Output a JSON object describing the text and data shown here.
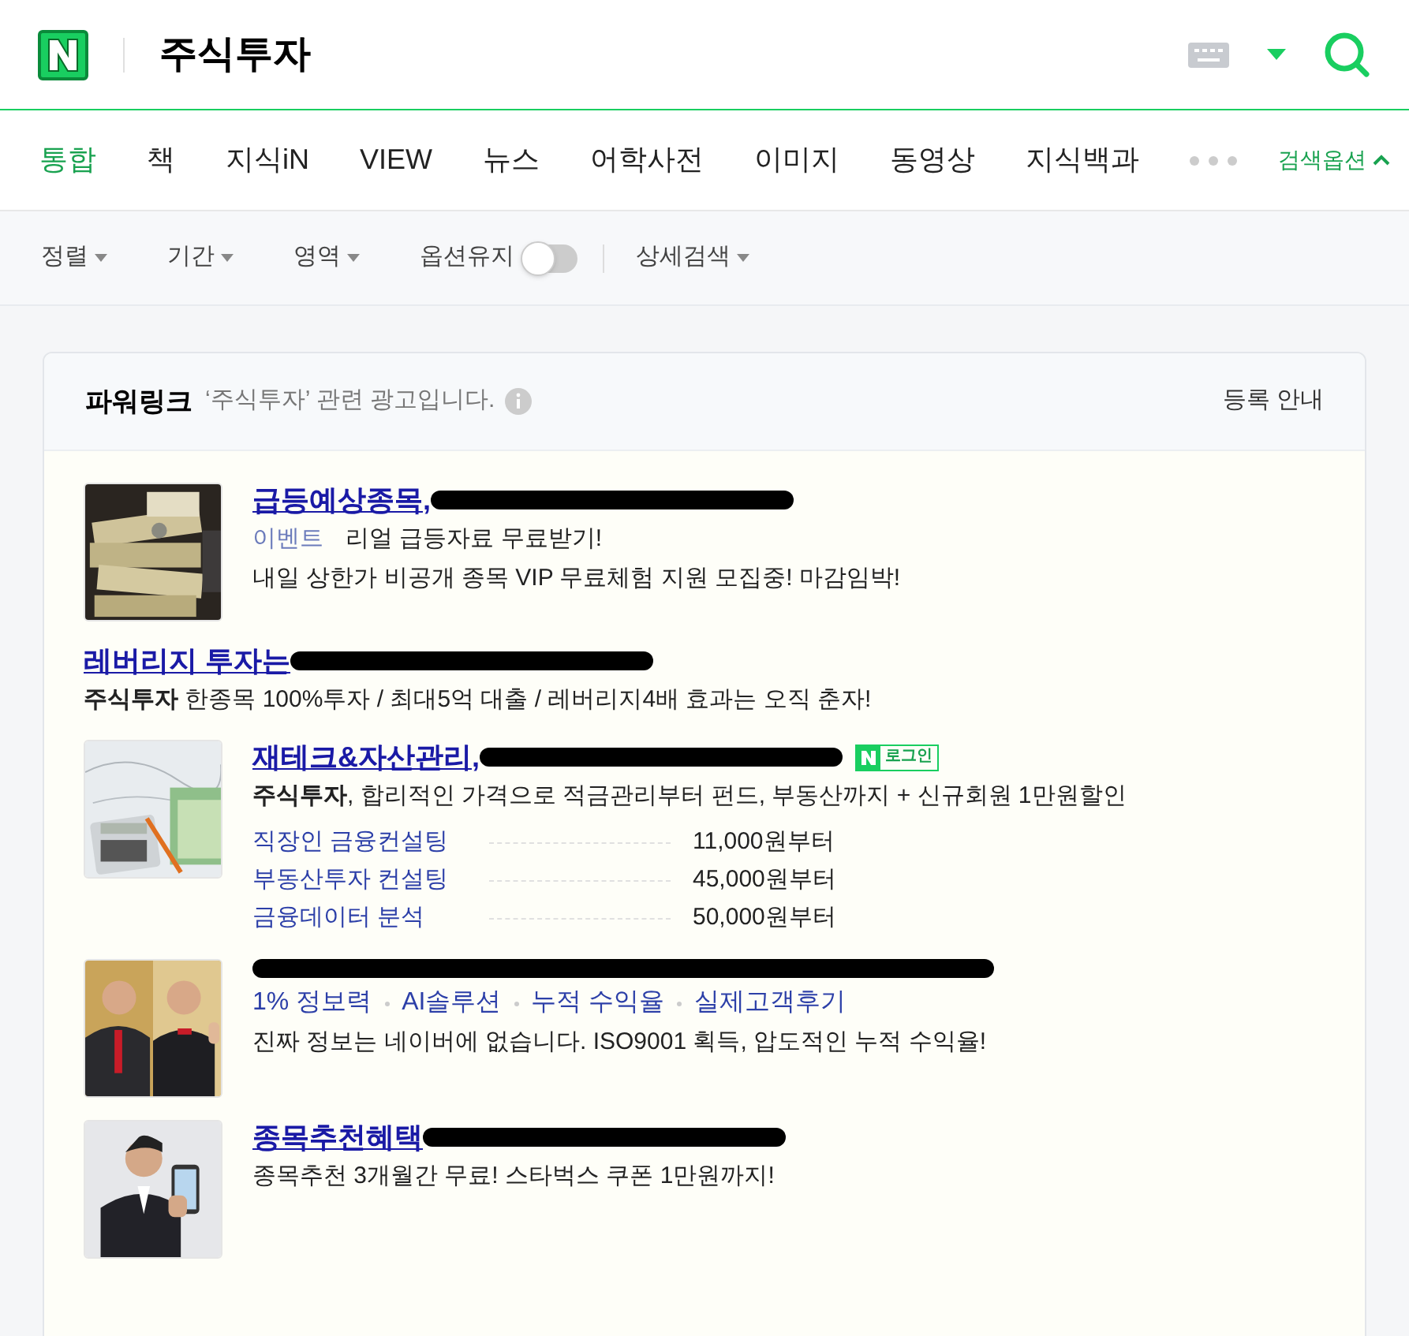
{
  "search": {
    "query": "주식투자"
  },
  "tabs": [
    {
      "label": "통합",
      "selected": true
    },
    {
      "label": "책",
      "selected": false
    },
    {
      "label": "지식iN",
      "selected": false
    },
    {
      "label": "VIEW",
      "selected": false
    },
    {
      "label": "뉴스",
      "selected": false
    },
    {
      "label": "어학사전",
      "selected": false
    },
    {
      "label": "이미지",
      "selected": false
    },
    {
      "label": "동영상",
      "selected": false
    },
    {
      "label": "지식백과",
      "selected": false
    }
  ],
  "search_options": {
    "label": "검색옵션",
    "expanded": true
  },
  "filters": [
    {
      "kind": "dropdown",
      "label": "정렬"
    },
    {
      "kind": "dropdown",
      "label": "기간"
    },
    {
      "kind": "dropdown",
      "label": "영역"
    },
    {
      "kind": "toggle",
      "label": "옵션유지",
      "on": false
    },
    {
      "kind": "dropdown",
      "label": "상세검색"
    }
  ],
  "powerlink": {
    "title": "파워링크",
    "subtitle": "‘주식투자’ 관련 광고입니다.",
    "register": "등록 안내",
    "ads": [
      {
        "image": {
          "kind": "picture"
        },
        "title": "급등예상종목,",
        "label": "이벤트",
        "lines": [
          "리얼 급등자료 무료받기!",
          "내일 상한가 비공개 종목 VIP 무료체험 지원 모집중! 마감임박!"
        ]
      },
      {
        "title": "레버리지 투자는",
        "lines": [
          "**주식투자** 한종목 100%투자 / 최대5억 대출 / 레버리지4배 효과는 오직 춘자!"
        ]
      },
      {
        "image": {
          "kind": "picture"
        },
        "title": "재테크&자산관리,",
        "login_badge": "로그인",
        "lines": [
          "**주식투자**, 합리적인 가격으로 적금관리부터 펀드, 부동산까지 + 신규회원 1만원할인"
        ],
        "sublinks": [
          {
            "label": "직장인 금융컨설팅",
            "price": "11,000원부터"
          },
          {
            "label": "부동산투자 컨설팅",
            "price": "45,000원부터"
          },
          {
            "label": "금융데이터 분석",
            "price": "50,000원부터"
          }
        ]
      },
      {
        "image": {
          "kind": "picture"
        },
        "tags": [
          "1% 정보력",
          "AI솔루션",
          "누적 수익율",
          "실제고객후기"
        ],
        "lines": [
          "진짜 정보는 네이버에 없습니다. ISO9001 획득, 압도적인 누적 수익율!"
        ]
      },
      {
        "image": {
          "kind": "picture"
        },
        "title": "종목추천혜택",
        "lines": [
          "종목추천 3개월간 무료! 스타벅스 쿠폰 1만원까지!"
        ]
      }
    ]
  }
}
